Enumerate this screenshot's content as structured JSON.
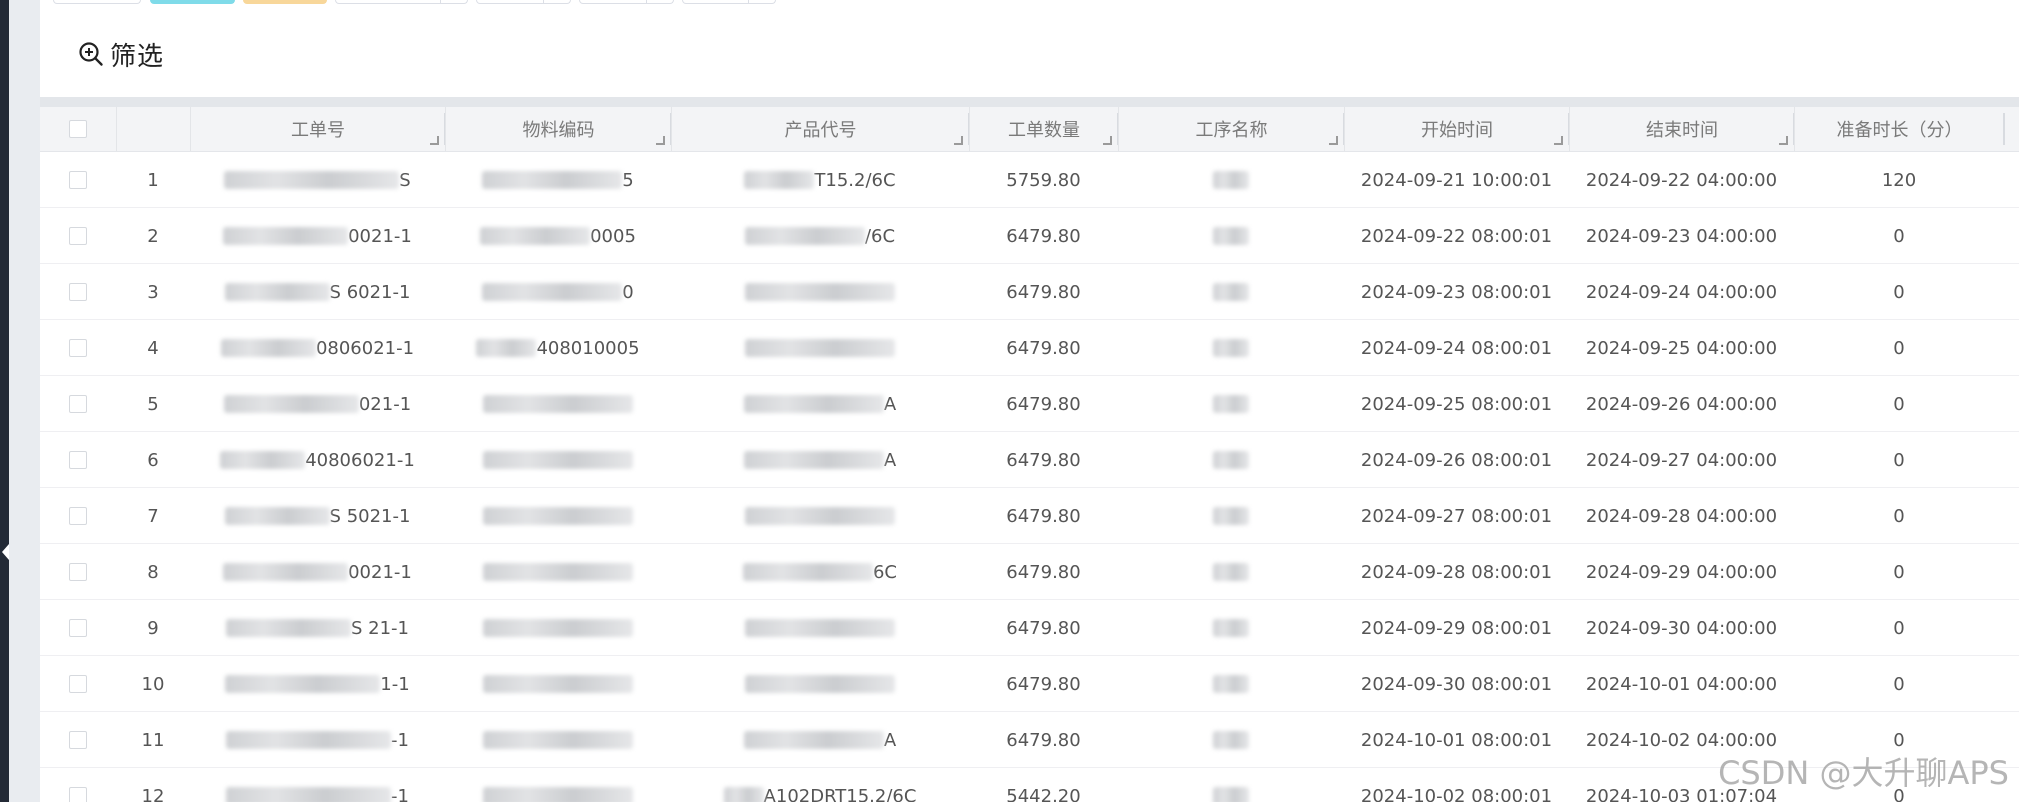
{
  "filter": {
    "label": "筛选",
    "icon": "zoom-in-icon"
  },
  "table": {
    "columns": [
      {
        "key": "select",
        "label": ""
      },
      {
        "key": "index",
        "label": ""
      },
      {
        "key": "work_order_no",
        "label": "工单号"
      },
      {
        "key": "material_code",
        "label": "物料编码"
      },
      {
        "key": "product_code",
        "label": "产品代号"
      },
      {
        "key": "order_qty",
        "label": "工单数量"
      },
      {
        "key": "process_name",
        "label": "工序名称"
      },
      {
        "key": "start_time",
        "label": "开始时间"
      },
      {
        "key": "end_time",
        "label": "结束时间"
      },
      {
        "key": "prep_minutes",
        "label": "准备时长（分）"
      }
    ],
    "rows": [
      {
        "index": "1",
        "work_order_no": "S",
        "material_code": "5",
        "product_code": "T15.2/6C",
        "order_qty": "5759.80",
        "start_time": "2024-09-21 10:00:01",
        "end_time": "2024-09-22 04:00:00",
        "prep_minutes": "120"
      },
      {
        "index": "2",
        "work_order_no": "0021-1",
        "material_code": "0005",
        "product_code": "/6C",
        "order_qty": "6479.80",
        "start_time": "2024-09-22 08:00:01",
        "end_time": "2024-09-23 04:00:00",
        "prep_minutes": "0"
      },
      {
        "index": "3",
        "work_order_no": "S 6021-1",
        "material_code": "0",
        "product_code": "",
        "order_qty": "6479.80",
        "start_time": "2024-09-23 08:00:01",
        "end_time": "2024-09-24 04:00:00",
        "prep_minutes": "0"
      },
      {
        "index": "4",
        "work_order_no": "0806021-1",
        "material_code": "408010005",
        "product_code": "",
        "order_qty": "6479.80",
        "start_time": "2024-09-24 08:00:01",
        "end_time": "2024-09-25 04:00:00",
        "prep_minutes": "0"
      },
      {
        "index": "5",
        "work_order_no": "021-1",
        "material_code": "",
        "product_code": "A",
        "order_qty": "6479.80",
        "start_time": "2024-09-25 08:00:01",
        "end_time": "2024-09-26 04:00:00",
        "prep_minutes": "0"
      },
      {
        "index": "6",
        "work_order_no": "40806021-1",
        "material_code": "",
        "product_code": "A",
        "order_qty": "6479.80",
        "start_time": "2024-09-26 08:00:01",
        "end_time": "2024-09-27 04:00:00",
        "prep_minutes": "0"
      },
      {
        "index": "7",
        "work_order_no": "S 5021-1",
        "material_code": "",
        "product_code": "",
        "order_qty": "6479.80",
        "start_time": "2024-09-27 08:00:01",
        "end_time": "2024-09-28 04:00:00",
        "prep_minutes": "0"
      },
      {
        "index": "8",
        "work_order_no": "0021-1",
        "material_code": "",
        "product_code": "6C",
        "order_qty": "6479.80",
        "start_time": "2024-09-28 08:00:01",
        "end_time": "2024-09-29 04:00:00",
        "prep_minutes": "0"
      },
      {
        "index": "9",
        "work_order_no": "S 21-1",
        "material_code": "",
        "product_code": "",
        "order_qty": "6479.80",
        "start_time": "2024-09-29 08:00:01",
        "end_time": "2024-09-30 04:00:00",
        "prep_minutes": "0"
      },
      {
        "index": "10",
        "work_order_no": "1-1",
        "material_code": "",
        "product_code": "",
        "order_qty": "6479.80",
        "start_time": "2024-09-30 08:00:01",
        "end_time": "2024-10-01 04:00:00",
        "prep_minutes": "0"
      },
      {
        "index": "11",
        "work_order_no": "-1",
        "material_code": "",
        "product_code": "A",
        "order_qty": "6479.80",
        "start_time": "2024-10-01 08:00:01",
        "end_time": "2024-10-02 04:00:00",
        "prep_minutes": "0"
      },
      {
        "index": "12",
        "work_order_no": "-1",
        "material_code": "",
        "product_code": "A102DRT15.2/6C",
        "order_qty": "5442.20",
        "start_time": "2024-10-02 08:00:01",
        "end_time": "2024-10-03 01:07:04",
        "prep_minutes": "0"
      }
    ]
  },
  "watermark": "CSDN @大升聊APS",
  "colors": {
    "toolbar_cyan": "#7fdbe9",
    "toolbar_amber": "#f8d79a",
    "sidebar": "#232a36"
  }
}
